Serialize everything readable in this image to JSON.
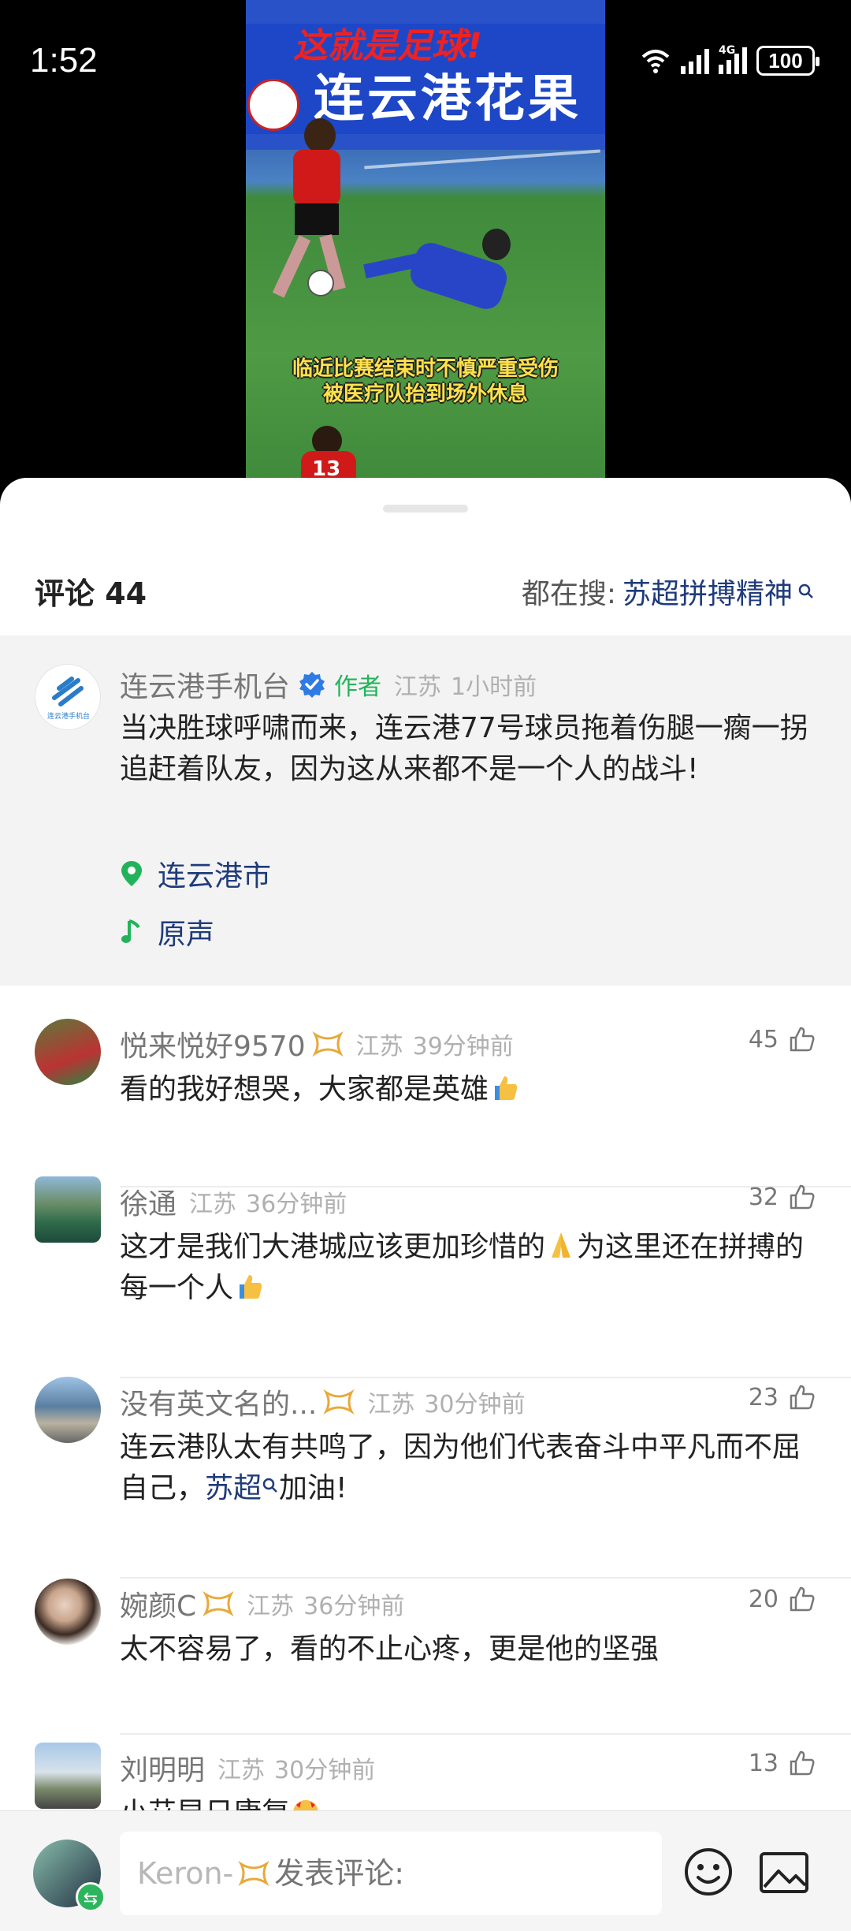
{
  "status_bar": {
    "time": "1:52",
    "battery": "100",
    "network": "4G"
  },
  "video": {
    "banner_top": "这就是足球!",
    "banner_text": "连云港花果",
    "caption_line1": "临近比赛结束时不慎严重受伤",
    "caption_line2": "被医疗队抬到场外休息",
    "player_number": "13"
  },
  "header": {
    "comments_label": "评论 44",
    "search_prefix": "都在搜:",
    "search_keyword": "苏超拼搏精神"
  },
  "author_comment": {
    "name": "连云港手机台",
    "tag": "作者",
    "region": "江苏",
    "time": "1小时前",
    "text": "当决胜球呼啸而来，连云港77号球员拖着伤腿一瘸一拐追赶着队友，因为这从来都不是一个人的战斗!",
    "location": "连云港市",
    "sound": "原声",
    "avatar_label": "连云港手机台"
  },
  "comments": [
    {
      "name": "悦来悦好9570",
      "region": "江苏",
      "time": "39分钟前",
      "likes": "45",
      "text": "看的我好想哭，大家都是英雄"
    },
    {
      "name": "徐通",
      "region": "江苏",
      "time": "36分钟前",
      "likes": "32",
      "text_a": "这才是我们大港城应该更加珍惜的",
      "text_b": "为这里还在拼搏的每一个人"
    },
    {
      "name": "没有英文名的...",
      "region": "江苏",
      "time": "30分钟前",
      "likes": "23",
      "text_a": "连云港队太有共鸣了，因为他们代表奋斗中平凡而不屈自己，",
      "link": "苏超",
      "text_b": "加油!"
    },
    {
      "name": "婉颜C",
      "region": "江苏",
      "time": "36分钟前",
      "likes": "20",
      "text": "太不容易了，看的不止心疼，更是他的坚强"
    },
    {
      "name": "刘明明",
      "region": "江苏",
      "time": "30分钟前",
      "likes": "13",
      "text": "小艾早日康复"
    }
  ],
  "input": {
    "user": "Keron-",
    "placeholder": "发表评论:"
  },
  "colors": {
    "accent_link": "#1f3b7a",
    "author_tag": "#22b35a",
    "vip": "#e8a93a"
  }
}
